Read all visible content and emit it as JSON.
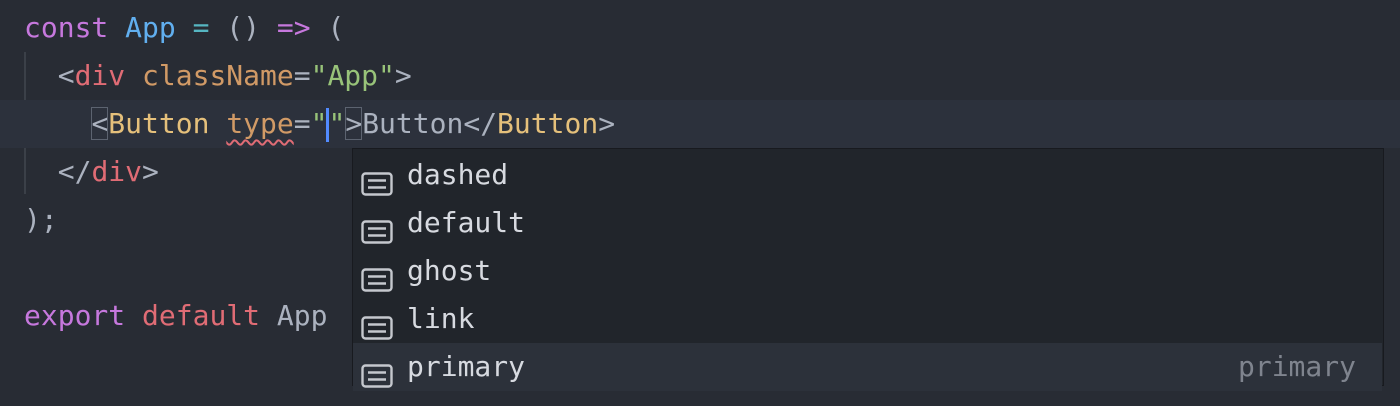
{
  "editor": {
    "lines": [
      {
        "tokens": [
          {
            "t": "const",
            "c": "kw"
          },
          {
            "t": " "
          },
          {
            "t": "App",
            "c": "fn"
          },
          {
            "t": " "
          },
          {
            "t": "=",
            "c": "op"
          },
          {
            "t": " () "
          },
          {
            "t": "=>",
            "c": "kw"
          },
          {
            "t": " ("
          }
        ]
      },
      {
        "tokens": [
          {
            "t": "  <"
          },
          {
            "t": "div",
            "c": "tag"
          },
          {
            "t": " "
          },
          {
            "t": "className",
            "c": "attr"
          },
          {
            "t": "="
          },
          {
            "t": "\"App\"",
            "c": "str"
          },
          {
            "t": ">"
          }
        ]
      },
      {
        "tokens": [
          {
            "t": "    "
          },
          {
            "t": "<",
            "c": "bm"
          },
          {
            "t": "Button",
            "c": "comp"
          },
          {
            "t": " "
          },
          {
            "t": "type",
            "c": "attr squiggle"
          },
          {
            "t": "="
          },
          {
            "t": "\"",
            "c": "str"
          },
          {
            "cursor": true
          },
          {
            "t": "\"",
            "c": "str"
          },
          {
            "t": ">",
            "c": "bm"
          },
          {
            "t": "Button</"
          },
          {
            "t": "Button",
            "c": "comp"
          },
          {
            "t": ">"
          }
        ]
      },
      {
        "tokens": [
          {
            "t": "  </"
          },
          {
            "t": "div",
            "c": "tag"
          },
          {
            "t": ">"
          }
        ]
      },
      {
        "tokens": [
          {
            "t": ");"
          }
        ]
      },
      {
        "tokens": []
      },
      {
        "tokens": [
          {
            "t": "export",
            "c": "kw"
          },
          {
            "t": " "
          },
          {
            "t": "default",
            "c": "tag"
          },
          {
            "t": " App"
          }
        ]
      }
    ]
  },
  "suggestions": {
    "items": [
      {
        "label": "dashed",
        "detail": "",
        "icon": "enum-member-icon"
      },
      {
        "label": "default",
        "detail": "",
        "icon": "enum-member-icon"
      },
      {
        "label": "ghost",
        "detail": "",
        "icon": "enum-member-icon"
      },
      {
        "label": "link",
        "detail": "",
        "icon": "enum-member-icon"
      },
      {
        "label": "primary",
        "detail": "primary",
        "icon": "enum-member-icon"
      }
    ],
    "selected_index": 4
  },
  "colors": {
    "background": "#282c34",
    "keyword": "#c678dd",
    "function": "#61afef",
    "tag": "#e06c75",
    "attribute": "#d19a66",
    "string": "#98c379",
    "component": "#e5c07b",
    "cursor": "#528bff"
  }
}
